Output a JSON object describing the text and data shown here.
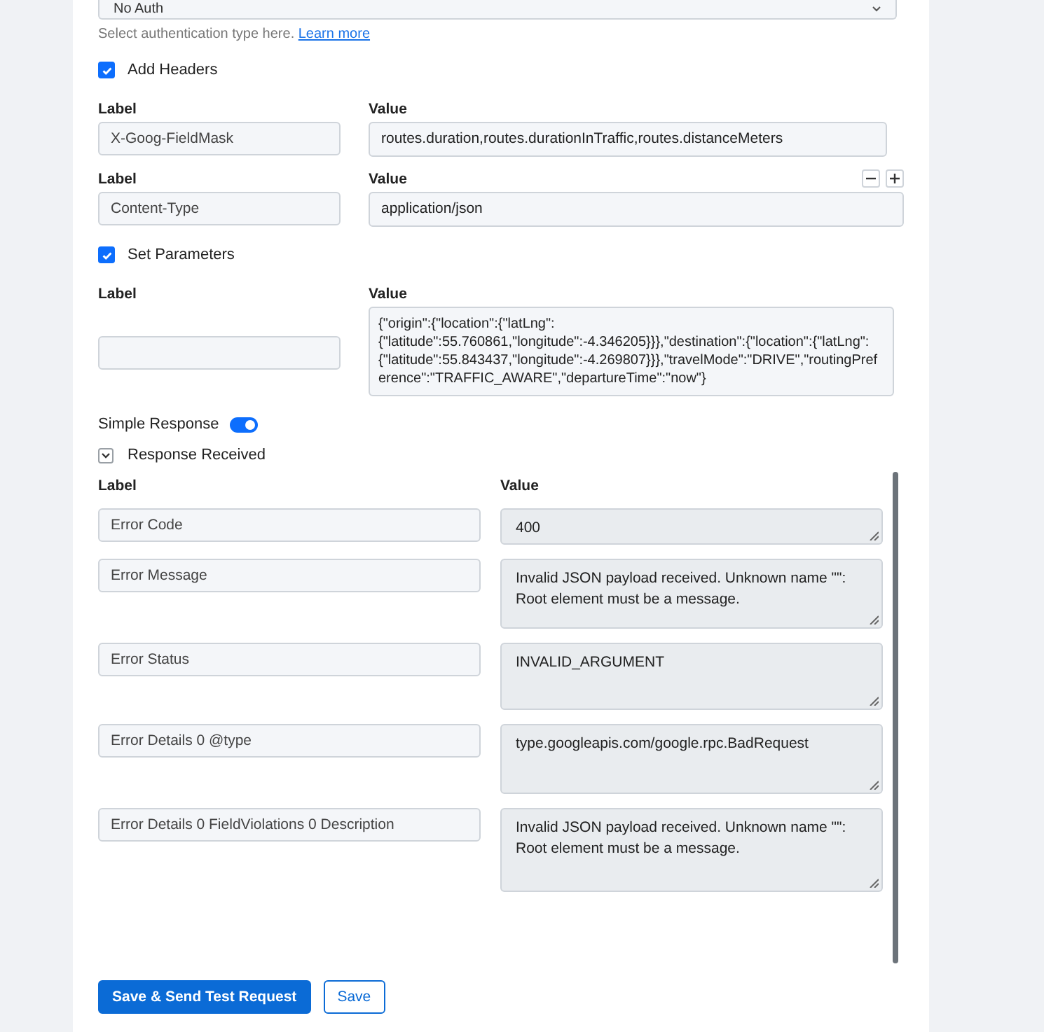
{
  "auth": {
    "value": "No Auth",
    "hint": "Select authentication type here.",
    "link": "Learn more"
  },
  "headers": {
    "label": "Add Headers",
    "checked": true,
    "rows": [
      {
        "label_heading": "Label",
        "value_heading": "Value",
        "label": "X-Goog-FieldMask",
        "value": "routes.duration,routes.durationInTraffic,routes.distanceMeters"
      },
      {
        "label_heading": "Label",
        "value_heading": "Value",
        "label": "Content-Type",
        "value": "application/json"
      }
    ]
  },
  "parameters": {
    "label": "Set Parameters",
    "checked": true,
    "rows": [
      {
        "label_heading": "Label",
        "value_heading": "Value",
        "value": "{\"origin\":{\"location\":{\"latLng\":{\"latitude\":55.760861,\"longitude\":-4.346205}}},\"destination\":{\"location\":{\"latLng\":{\"latitude\":55.843437,\"longitude\":-4.269807}}},\"travelMode\":\"DRIVE\",\"routingPreference\":\"TRAFFIC_AWARE\",\"departureTime\":\"now\"}"
      }
    ]
  },
  "simple_response": {
    "label": "Simple Response",
    "on": true
  },
  "response": {
    "label": "Response Received",
    "expanded": true,
    "columns": [
      "Label",
      "Value"
    ],
    "rows": [
      {
        "label": "Error Code",
        "value": "400"
      },
      {
        "label": "Error Message",
        "value": "Invalid JSON payload received. Unknown name \"\": Root element must be a message."
      },
      {
        "label": "Error Status",
        "value": "INVALID_ARGUMENT"
      },
      {
        "label": "Error Details 0 @type",
        "value": "type.googleapis.com/google.rpc.BadRequest"
      },
      {
        "label": "Error Details 0 FieldViolations 0 Description",
        "value": "Invalid JSON payload received. Unknown name \"\": Root element must be a message."
      }
    ]
  },
  "buttons": [
    {
      "label": "Save & Send Test Request",
      "kind": "primary"
    },
    {
      "label": "Save",
      "kind": "secondary"
    }
  ]
}
